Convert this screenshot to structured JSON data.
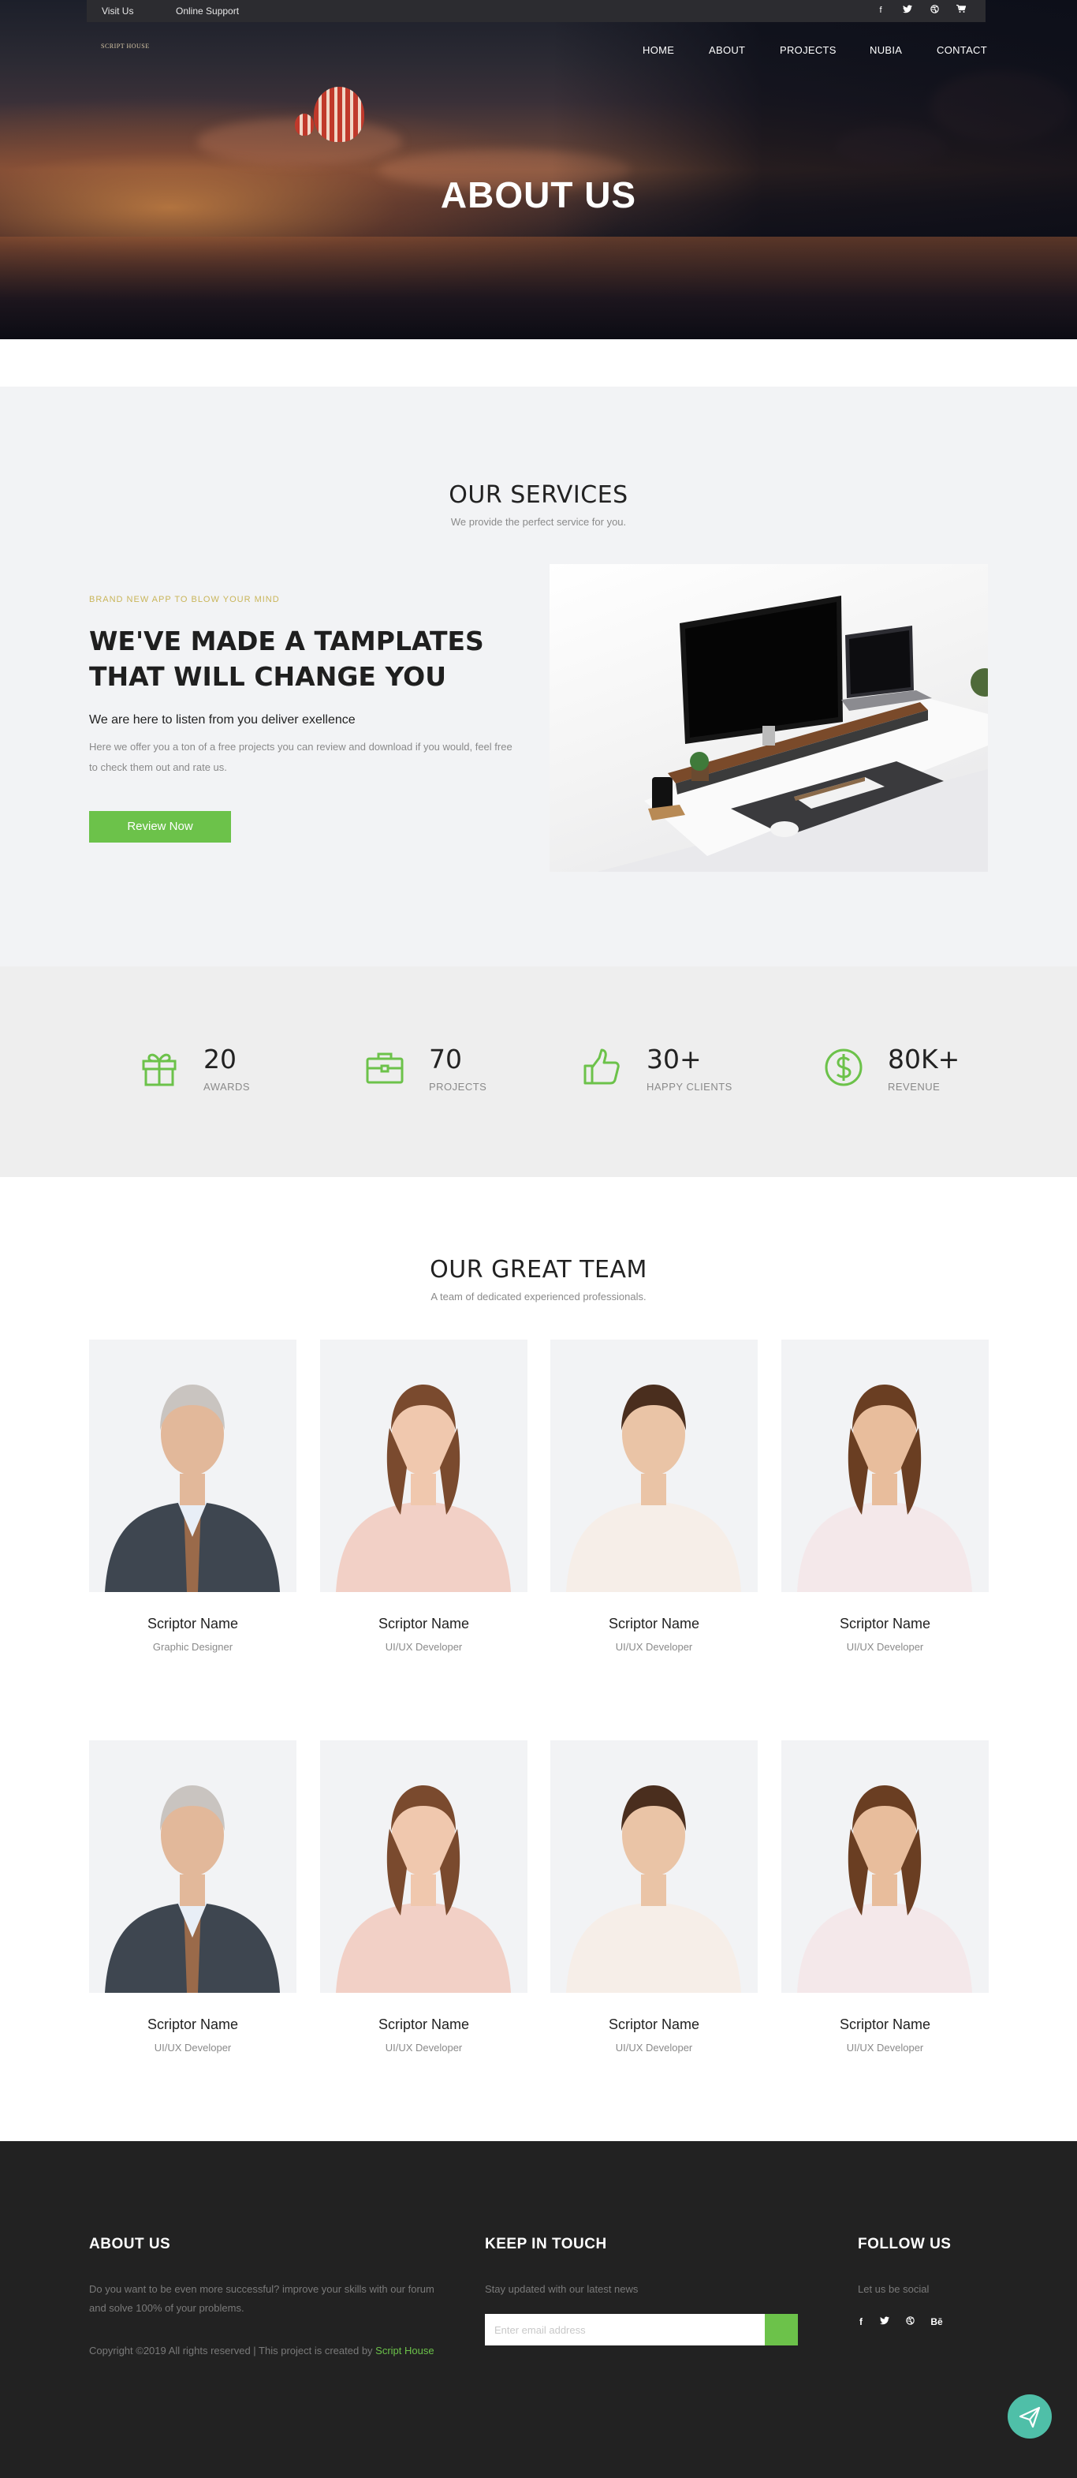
{
  "topbar": {
    "links": [
      "Visit Us",
      "Online Support"
    ],
    "social_icons": [
      "facebook-icon",
      "twitter-icon",
      "dribbble-icon",
      "cart-icon"
    ]
  },
  "brand": {
    "logo_text": "SCRIPT HOUSE"
  },
  "nav": {
    "items": [
      "HOME",
      "ABOUT",
      "PROJECTS",
      "NUBIA",
      "CONTACT"
    ]
  },
  "hero": {
    "title": "ABOUT US"
  },
  "services": {
    "title": "OUR SERVICES",
    "subtitle": "We provide the perfect service for you.",
    "eyebrow": "BRAND NEW APP TO BLOW YOUR MIND",
    "headline_line1": "WE'VE MADE A TAMPLATES",
    "headline_line2": "THAT WILL CHANGE YOU",
    "lead": "We are here to listen from you deliver exellence",
    "body": "Here we offer you a ton of a free projects you can review and download if you would, feel free to check them out and rate us.",
    "button_label": "Review Now"
  },
  "stats": [
    {
      "number": "20",
      "label": "AWARDS",
      "icon": "gift-icon"
    },
    {
      "number": "70",
      "label": "PROJECTS",
      "icon": "briefcase-icon"
    },
    {
      "number": "30+",
      "label": "HAPPY CLIENTS",
      "icon": "thumbs-up-icon"
    },
    {
      "number": "80K+",
      "label": "REVENUE",
      "icon": "dollar-icon"
    }
  ],
  "team": {
    "title": "OUR GREAT TEAM",
    "subtitle": "A team of dedicated experienced professionals.",
    "members": [
      {
        "name": "Scriptor Name",
        "role": "Graphic Designer"
      },
      {
        "name": "Scriptor Name",
        "role": "UI/UX Developer"
      },
      {
        "name": "Scriptor Name",
        "role": "UI/UX Developer"
      },
      {
        "name": "Scriptor Name",
        "role": "UI/UX Developer"
      },
      {
        "name": "Scriptor Name",
        "role": "UI/UX Developer"
      },
      {
        "name": "Scriptor Name",
        "role": "UI/UX Developer"
      },
      {
        "name": "Scriptor Name",
        "role": "UI/UX Developer"
      },
      {
        "name": "Scriptor Name",
        "role": "UI/UX Developer"
      }
    ]
  },
  "footer": {
    "about_title": "ABOUT US",
    "about_text": "Do you want to be even more successful? improve your skills with our forum and solve 100% of your problems.",
    "copyright_prefix": "Copyright ©2019 All rights reserved | This project is created by ",
    "copyright_link": "Script House",
    "keep_title": "KEEP IN TOUCH",
    "keep_text": "Stay updated with our latest news",
    "email_placeholder": "Enter email address",
    "follow_title": "FOLLOW US",
    "follow_text": "Let us be social",
    "social": [
      "f",
      "t",
      "d",
      "Bē"
    ]
  },
  "colors": {
    "accent": "#6cc24a",
    "eyebrow": "#c9b55a",
    "footer_bg": "#222222",
    "fab": "#4fbfa8"
  }
}
